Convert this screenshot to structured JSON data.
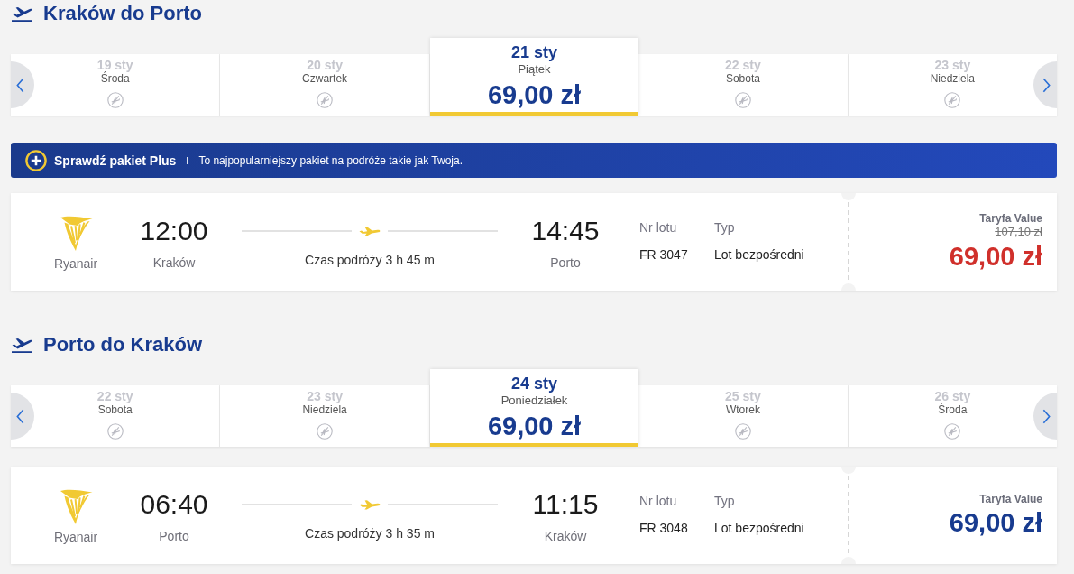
{
  "sections": [
    {
      "title": "Kraków do Porto",
      "dates": [
        {
          "date": "19 sty",
          "day": "Środa",
          "available": false,
          "selected": false
        },
        {
          "date": "20 sty",
          "day": "Czwartek",
          "available": false,
          "selected": false
        },
        {
          "date": "21 sty",
          "day": "Piątek",
          "price": "69,00 zł",
          "available": true,
          "selected": true
        },
        {
          "date": "22 sty",
          "day": "Sobota",
          "available": false,
          "selected": false
        },
        {
          "date": "23 sty",
          "day": "Niedziela",
          "available": false,
          "selected": false
        }
      ],
      "promo_banner": {
        "title": "Sprawdź pakiet Plus",
        "text": "To najpopularniejszy pakiet na podróże takie jak Twoja."
      },
      "flight": {
        "airline": "Ryanair",
        "departure_time": "12:00",
        "departure_city": "Kraków",
        "duration": "Czas podróży 3 h 45 m",
        "arrival_time": "14:45",
        "arrival_city": "Porto",
        "flight_number_label": "Nr lotu",
        "flight_number": "FR 3047",
        "type_label": "Typ",
        "type": "Lot bezpośredni",
        "fare_name": "Taryfa Value",
        "old_price": "107,10 zł",
        "price": "69,00 zł",
        "discounted": true
      }
    },
    {
      "title": "Porto do Kraków",
      "dates": [
        {
          "date": "22 sty",
          "day": "Sobota",
          "available": false,
          "selected": false
        },
        {
          "date": "23 sty",
          "day": "Niedziela",
          "available": false,
          "selected": false
        },
        {
          "date": "24 sty",
          "day": "Poniedziałek",
          "price": "69,00 zł",
          "available": true,
          "selected": true
        },
        {
          "date": "25 sty",
          "day": "Wtorek",
          "available": false,
          "selected": false
        },
        {
          "date": "26 sty",
          "day": "Środa",
          "available": false,
          "selected": false
        }
      ],
      "flight": {
        "airline": "Ryanair",
        "departure_time": "06:40",
        "departure_city": "Porto",
        "duration": "Czas podróży 3 h 35 m",
        "arrival_time": "11:15",
        "arrival_city": "Kraków",
        "flight_number_label": "Nr lotu",
        "flight_number": "FR 3048",
        "type_label": "Typ",
        "type": "Lot bezpośredni",
        "fare_name": "Taryfa Value",
        "price": "69,00 zł",
        "discounted": false
      }
    }
  ]
}
